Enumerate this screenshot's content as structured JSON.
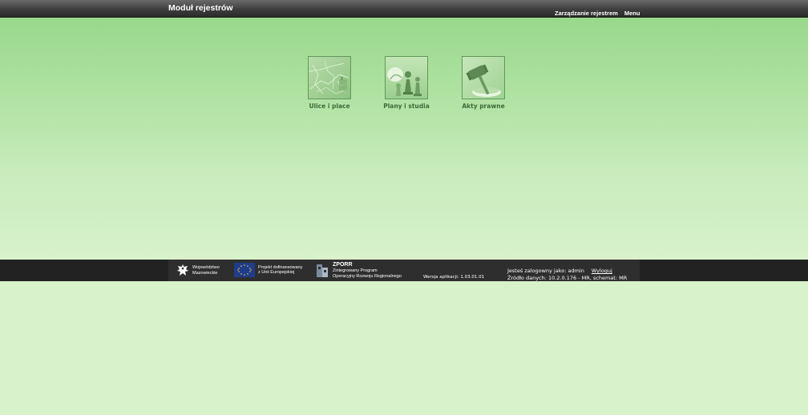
{
  "header": {
    "title": "Moduł rejestrów",
    "nav": [
      "Zarządzanie rejestrem",
      "Menu"
    ]
  },
  "tiles": [
    {
      "label": "Ulice i place",
      "icon": "map-streets-icon"
    },
    {
      "label": "Plany i studia",
      "icon": "chess-pieces-icon"
    },
    {
      "label": "Akty prawne",
      "icon": "gavel-icon"
    }
  ],
  "footer": {
    "logo_mazowsze": [
      "Województwo",
      "Mazowieckie"
    ],
    "logo_eu": [
      "Projekt dofinansowany",
      "z Unii Europejskiej"
    ],
    "logo_zporr_title": "ZPORR",
    "logo_zporr": [
      "Zintegrowany Program",
      "Operacyjny Rozwoju Regionalnego"
    ],
    "version": "Wersja aplikacji: 1.03.01.01",
    "logged_in": "Jesteś zalogowny jako: admin",
    "logout": "Wyloguj",
    "source": "Źródło danych: 10.2.0.176 - MR, schemat: MR"
  },
  "colors": {
    "header_bg": "#3e3e3e",
    "content_top": "#98d88c",
    "content_bottom": "#d8f2cc",
    "tile_label": "#3d6a38",
    "footer_bg": "#222222"
  }
}
